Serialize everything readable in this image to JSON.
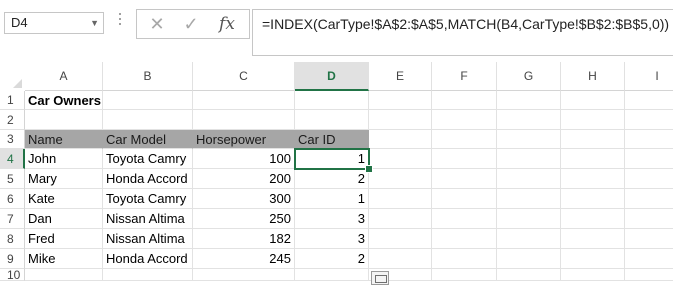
{
  "formula_bar": {
    "name_box": "D4",
    "formula": "=INDEX(CarType!$A$2:$A$5,MATCH(B4,CarType!$B$2:$B$5,0))",
    "cancel_icon": "✕",
    "enter_icon": "✓",
    "fx_label": "fx"
  },
  "columns": [
    "A",
    "B",
    "C",
    "D",
    "E",
    "F",
    "G",
    "H",
    "I"
  ],
  "active_column": "D",
  "rows": [
    "1",
    "2",
    "3",
    "4",
    "5",
    "6",
    "7",
    "8",
    "9",
    "10"
  ],
  "active_row": "4",
  "sheet": {
    "title": "Car Owners",
    "headers": [
      "Name",
      "Car Model",
      "Horsepower",
      "Car ID"
    ],
    "data": [
      {
        "name": "John",
        "model": "Toyota Camry",
        "hp": "100",
        "id": "1"
      },
      {
        "name": "Mary",
        "model": "Honda Accord",
        "hp": "200",
        "id": "2"
      },
      {
        "name": "Kate",
        "model": "Toyota Camry",
        "hp": "300",
        "id": "1"
      },
      {
        "name": "Dan",
        "model": "Nissan Altima",
        "hp": "250",
        "id": "3"
      },
      {
        "name": "Fred",
        "model": "Nissan Altima",
        "hp": "182",
        "id": "3"
      },
      {
        "name": "Mike",
        "model": "Honda Accord",
        "hp": "245",
        "id": "2"
      }
    ]
  },
  "colors": {
    "accent": "#217346",
    "header_fill": "#a6a6a6"
  }
}
